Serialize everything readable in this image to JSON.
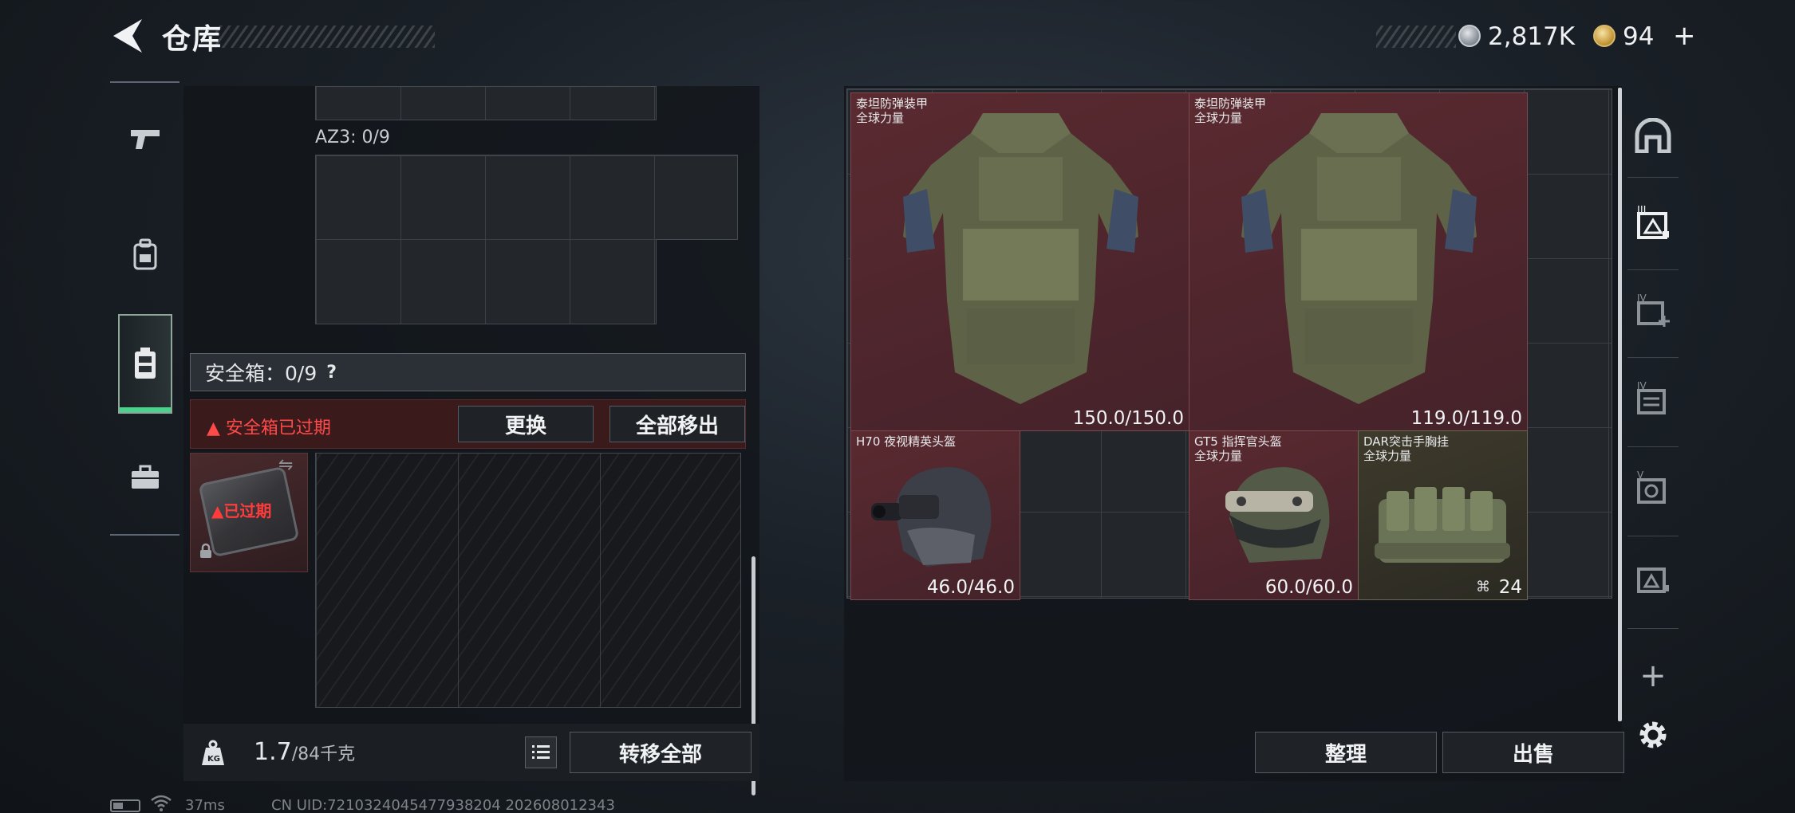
{
  "header": {
    "title": "仓库",
    "back_icon": "back-arrow-icon",
    "currency": [
      {
        "icon": "silver-coin-icon",
        "amount": "2,817K"
      },
      {
        "icon": "gold-coin-icon",
        "amount": "94",
        "add_label": "+"
      }
    ]
  },
  "left_tabs": [
    {
      "icon": "pistol-icon"
    },
    {
      "icon": "backpack-icon"
    },
    {
      "icon": "vest-icon",
      "active": true
    },
    {
      "icon": "briefcase-icon"
    }
  ],
  "left_panel": {
    "az3_label": "AZ3: 0/9",
    "safebox_label": "安全箱：0/9",
    "safebox_help": "?",
    "expired_text": "安全箱已过期",
    "replace_button": "更换",
    "move_all_button": "全部移出",
    "safebox_item_status": "已过期",
    "weight_value": "1.7",
    "weight_unit": "/84千克",
    "transfer_all_button": "转移全部"
  },
  "stash": {
    "items": [
      {
        "name": "泰坦防弹装甲\n全球力量",
        "durability": "150.0/150.0",
        "type": "armor"
      },
      {
        "name": "泰坦防弹装甲\n全球力量",
        "durability": "119.0/119.0",
        "type": "armor"
      },
      {
        "name": "H70 夜视精英头盔",
        "durability": "46.0/46.0",
        "type": "helmet"
      },
      {
        "name": "GT5 指挥官头盔\n全球力量",
        "durability": "60.0/60.0",
        "type": "helmet"
      },
      {
        "name": "DAR突击手胸挂\n全球力量",
        "count": "24",
        "type": "chest-rig"
      }
    ],
    "sort_button": "整理",
    "sell_button": "出售"
  },
  "right_tabs": [
    {
      "icon": "arch-icon"
    },
    {
      "icon": "stash-page-1-icon"
    },
    {
      "icon": "stash-page-iv-add-icon"
    },
    {
      "icon": "stash-page-iv-icon"
    },
    {
      "icon": "stash-page-v-icon"
    },
    {
      "icon": "stash-page-extra-icon"
    },
    {
      "icon": "add-page-icon"
    },
    {
      "icon": "settings-gear-icon"
    }
  ],
  "status_bar": {
    "ping": "37ms",
    "uid": "CN UID:7210324045477938204  202608012343"
  },
  "colors": {
    "item_red_bg": "#4f262c",
    "item_tan_bg": "#3a3729",
    "expired_red": "#ff4a4a",
    "active_tab_green": "#47d38b"
  }
}
